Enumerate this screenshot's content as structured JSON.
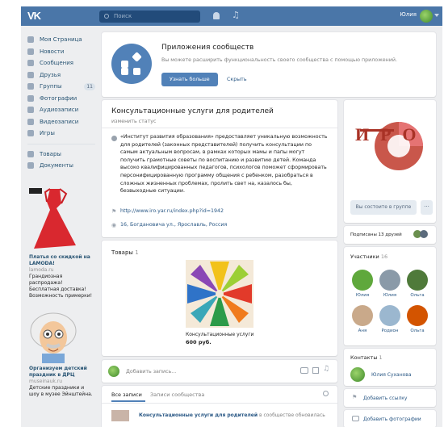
{
  "colors": {
    "header": "#4a76a8",
    "accent": "#5181b8",
    "link": "#2a5885"
  },
  "header": {
    "logo": "VK",
    "search_placeholder": "Поиск",
    "user_name": "Юлия",
    "icons": [
      "search-icon",
      "bell-icon",
      "music-icon",
      "chevron-down-icon"
    ]
  },
  "nav": [
    {
      "label": "Моя Страница",
      "icon": "home-icon"
    },
    {
      "label": "Новости",
      "icon": "news-icon"
    },
    {
      "label": "Сообщения",
      "icon": "message-icon"
    },
    {
      "label": "Друзья",
      "icon": "friends-icon"
    },
    {
      "label": "Группы",
      "icon": "groups-icon",
      "badge": "11"
    },
    {
      "label": "Фотографии",
      "icon": "camera-icon"
    },
    {
      "label": "Аудиозаписи",
      "icon": "music-icon"
    },
    {
      "label": "Видеозаписи",
      "icon": "video-icon"
    },
    {
      "label": "Игры",
      "icon": "game-icon"
    },
    {
      "label": "Товары",
      "icon": "bag-icon"
    },
    {
      "label": "Документы",
      "icon": "document-icon"
    }
  ],
  "ads": [
    {
      "title": "Платья со скидкой на LAMODA!",
      "domain": "lamoda.ru",
      "text": "Грандиозная распродажа! Бесплатная доставка! Возможность примерки!"
    },
    {
      "title": "Организуем детский праздник в ДРЦ",
      "domain": "museinauk.ru",
      "text": "Детские праздники и шоу в музее Эйнштейна."
    }
  ],
  "apps": {
    "title": "Приложения сообществ",
    "desc": "Вы можете расширить функциональность своего сообщества с помощью приложений.",
    "btn": "Узнать больше",
    "hide": "Скрыть"
  },
  "group": {
    "name": "Консультационные услуги для родителей",
    "status": "изменить статус",
    "description": "«Институт развития образования» предоставляет уникальную возможность для родителей (законных представителей) получить консультации по самым актуальным вопросам, в рамках которых мамы и папы могут получить грамотные советы по воспитанию и развитию детей. Команда высоко квалифицированных педагогов, психологов поможет сформировать персонифицированную программу общения с ребенком, разобраться в сложных жизненных проблемах, пролить свет на, казалось бы, безвыходные ситуации.",
    "url": "http://www.iro.yar.ru/index.php?id=1942",
    "address": "16, Богдановича ул., Ярославль, Россия"
  },
  "goods": {
    "title": "Товары",
    "count": "1",
    "item_name": "Консультационные услуги",
    "item_price": "600 руб."
  },
  "composer": {
    "placeholder": "Добавить запись..."
  },
  "wall": {
    "tabs": [
      "Все записи",
      "Записи сообщества"
    ],
    "post_author": "Консультационные услуги для родителей",
    "post_tail": "в сообществе обновилась"
  },
  "right": {
    "logo_text": "ИРО",
    "member_btn": "Вы состоите в группе",
    "subscribed": "Подписаны 13 друзей",
    "members_title": "Участники",
    "members_count": "16",
    "members": [
      "Юлия",
      "Юлия",
      "Ольга",
      "Аня",
      "Родион",
      "Ольга"
    ],
    "contacts_title": "Контакты",
    "contacts_count": "1",
    "contact": "Юлия Суханова",
    "add_link": "Добавить ссылку",
    "add_photos": "Добавить фотографии"
  }
}
